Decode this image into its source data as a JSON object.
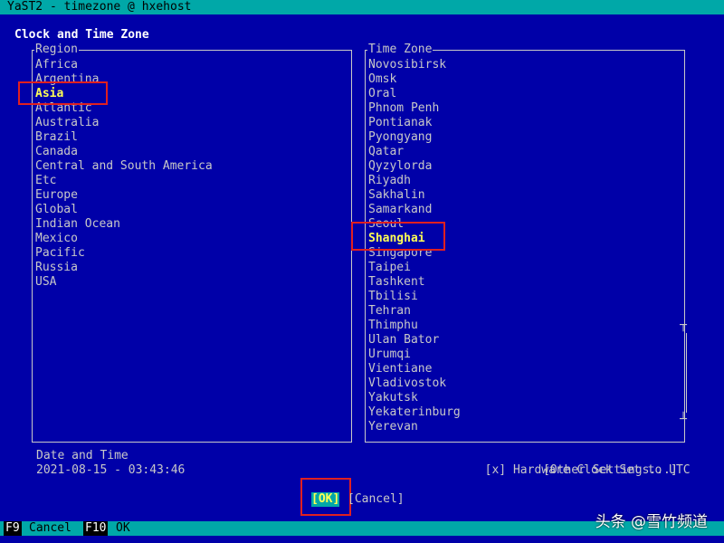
{
  "window": {
    "title": "YaST2 - timezone @ hxehost"
  },
  "dialog": {
    "heading": "Clock and Time Zone"
  },
  "region": {
    "label": "Region",
    "items": [
      "Africa",
      "Argentina",
      "Asia",
      "Atlantic",
      "Australia",
      "Brazil",
      "Canada",
      "Central and South America",
      "Etc",
      "Europe",
      "Global",
      "Indian Ocean",
      "Mexico",
      "Pacific",
      "Russia",
      "USA"
    ],
    "selected": "Asia"
  },
  "timezone": {
    "label": "Time Zone",
    "items": [
      "Novosibirsk",
      "Omsk",
      "Oral",
      "Phnom Penh",
      "Pontianak",
      "Pyongyang",
      "Qatar",
      "Qyzylorda",
      "Riyadh",
      "Sakhalin",
      "Samarkand",
      "Seoul",
      "Shanghai",
      "Singapore",
      "Taipei",
      "Tashkent",
      "Tbilisi",
      "Tehran",
      "Thimphu",
      "Ulan Bator",
      "Urumqi",
      "Vientiane",
      "Vladivostok",
      "Yakutsk",
      "Yekaterinburg",
      "Yerevan"
    ],
    "selected": "Shanghai"
  },
  "datetime": {
    "label": "Date and Time",
    "value": "2021-08-15 - 03:43:46"
  },
  "hardware_clock": {
    "checkbox": "[x]",
    "label": "Hardware Clock Set to UTC"
  },
  "other_settings": {
    "label": "[Other Settings...]"
  },
  "buttons": {
    "ok": "[OK]",
    "cancel": "[Cancel]"
  },
  "footer": {
    "f9_key": "F9",
    "f9_label": "Cancel",
    "f10_key": "F10",
    "f10_label": "OK"
  },
  "watermark": {
    "text": "头条 @雪竹频道"
  }
}
